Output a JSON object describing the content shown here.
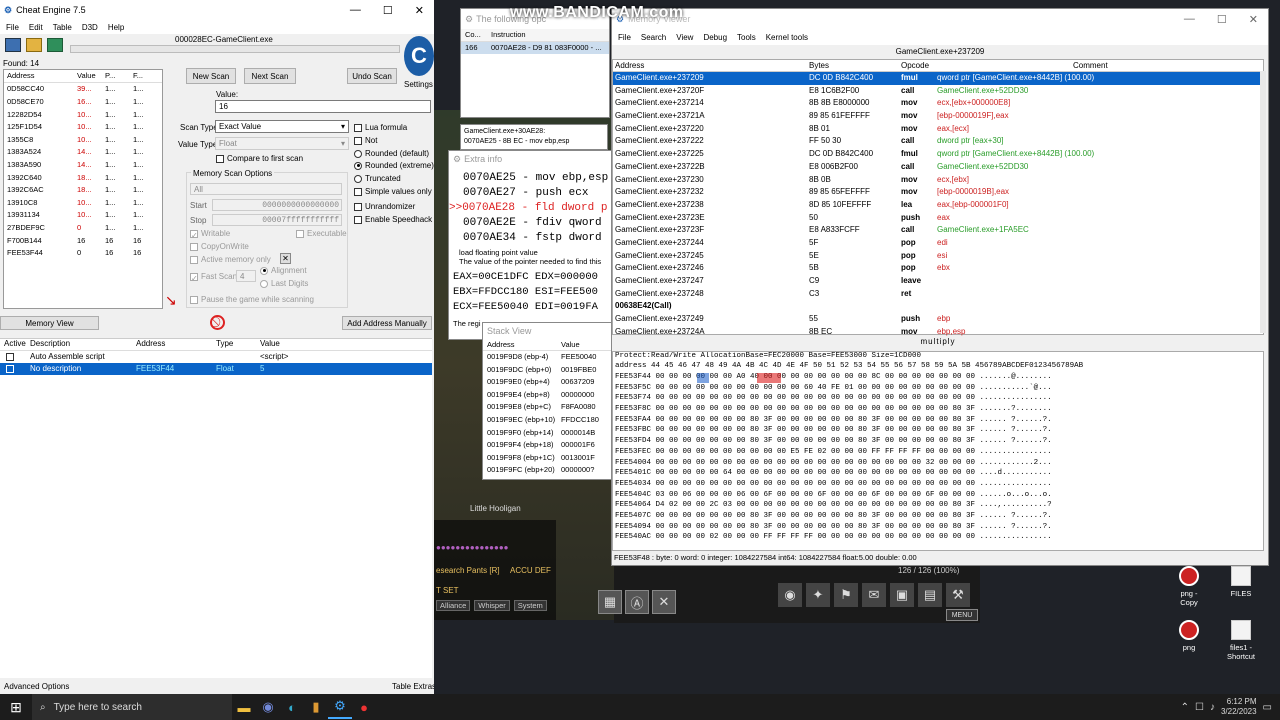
{
  "ce": {
    "title": "Cheat Engine 7.5",
    "menu": [
      "File",
      "Edit",
      "Table",
      "D3D",
      "Help"
    ],
    "process": "000028EC-GameClient.exe",
    "found": "Found: 14",
    "list_headers": [
      "Address",
      "Value",
      "P...",
      "F..."
    ],
    "rows": [
      [
        "0D58CC40",
        "39...",
        "1...",
        "1..."
      ],
      [
        "0D58CE70",
        "16...",
        "1...",
        "1..."
      ],
      [
        "12282D54",
        "10...",
        "1...",
        "1..."
      ],
      [
        "125F1D54",
        "10...",
        "1...",
        "1..."
      ],
      [
        "1355C8",
        "10...",
        "1...",
        "1..."
      ],
      [
        "1383A524",
        "14...",
        "1...",
        "1..."
      ],
      [
        "1383A590",
        "14...",
        "1...",
        "1..."
      ],
      [
        "1392C640",
        "18...",
        "1...",
        "1..."
      ],
      [
        "1392C6AC",
        "18...",
        "1...",
        "1..."
      ],
      [
        "13910C8",
        "10...",
        "1...",
        "1..."
      ],
      [
        "13931134",
        "10...",
        "1...",
        "1..."
      ],
      [
        "27BDEF9C",
        "0",
        "1...",
        "1..."
      ],
      [
        "F700B144",
        "16",
        "16",
        "16"
      ],
      [
        "FEE53F44",
        "0",
        "16",
        "16"
      ]
    ],
    "new_scan": "New Scan",
    "next_scan": "Next Scan",
    "undo_scan": "Undo Scan",
    "settings": "Settings",
    "value_label": "Value:",
    "value": "16",
    "scan_type_label": "Scan Type",
    "scan_type": "Exact Value",
    "value_type_label": "Value Type",
    "value_type": "Float",
    "compare_first": "Compare to first scan",
    "mem_opts": "Memory Scan Options",
    "mem_all": "All",
    "start_label": "Start",
    "start": "0000000000000000",
    "stop_label": "Stop",
    "stop": "00007fffffffffff",
    "writable": "Writable",
    "executable": "Executable",
    "copyonwrite": "CopyOnWrite",
    "active_mem": "Active memory only",
    "fast_scan": "Fast Scan",
    "fast_val": "4",
    "alignment": "Alignment",
    "last_digits": "Last Digits",
    "pause": "Pause the game while scanning",
    "lua": "Lua formula",
    "not": "Not",
    "rounded_default": "Rounded (default)",
    "rounded_extreme": "Rounded (extreme)",
    "truncated": "Truncated",
    "simple": "Simple values only",
    "unrandomizer": "Unrandomizer",
    "speedhack": "Enable Speedhack",
    "memory_view": "Memory View",
    "add_manual": "Add Address Manually",
    "table_headers": [
      "Active",
      "Description",
      "Address",
      "Type",
      "Value"
    ],
    "table_rows": [
      [
        "",
        "Auto Assemble script",
        "",
        "",
        "<script>"
      ],
      [
        "",
        "No description",
        "FEE53F44",
        "Float",
        "5"
      ]
    ],
    "advanced": "Advanced Options",
    "table_extras": "Table Extras"
  },
  "opcodes": {
    "title": "The following opc",
    "headers": [
      "Co...",
      "Instruction"
    ],
    "row": [
      "166",
      "0070AE28 - D9 81 083F0000 - ..."
    ],
    "tip": "GameClient.exe+30AE28:",
    "tip2": "0070AE25 - 8B EC - mov ebp,esp"
  },
  "extra": {
    "title": "Extra info",
    "lines": [
      "0070AE25 - mov ebp,esp",
      "0070AE27 - push ecx",
      ">>0070AE28 - fld dword p",
      "0070AE2E - fdiv qword",
      "0070AE34 - fstp dword"
    ],
    "note1": "load floating point value",
    "note2": "The value of the pointer needed to find this",
    "regs": [
      "EAX=00CE1DFC  EDX=000000",
      "EBX=FFDCC180  ESI=FEE500",
      "ECX=FEE50040  EDI=0019FA"
    ],
    "regs_note": "The regi"
  },
  "stack": {
    "title": "Stack View",
    "headers": [
      "Address",
      "Value"
    ],
    "rows": [
      [
        "0019F9D8 (ebp-4)",
        "FEE50040"
      ],
      [
        "0019F9DC (ebp+0)",
        "0019FBE0"
      ],
      [
        "0019F9E0 (ebp+4)",
        "00637209"
      ],
      [
        "0019F9E4 (ebp+8)",
        "00000000"
      ],
      [
        "0019F9E8 (ebp+C)",
        "F8FA0080"
      ],
      [
        "0019F9EC (ebp+10)",
        "FFDCC180"
      ],
      [
        "0019F9F0 (ebp+14)",
        "0000014B"
      ],
      [
        "0019F9F4 (ebp+18)",
        "000001F6"
      ],
      [
        "0019F9F8 (ebp+1C)",
        "0013001F"
      ],
      [
        "0019F9FC (ebp+20)",
        "0000000?"
      ]
    ]
  },
  "watermark": "www.BANDICAM.com",
  "memview": {
    "title": "Memory Viewer",
    "menu": [
      "File",
      "Search",
      "View",
      "Debug",
      "Tools",
      "Kernel tools"
    ],
    "location": "GameClient.exe+237209",
    "headers": [
      "Address",
      "Bytes",
      "Opcode",
      "Comment"
    ],
    "rows": [
      [
        "GameClient.exe+237209",
        "DC 0D B842C400",
        "fmul",
        "qword ptr [GameClient.exe+8442B] (100.00)"
      ],
      [
        "GameClient.exe+23720F",
        "E8 1C6B2F00",
        "call",
        "GameClient.exe+52DD30"
      ],
      [
        "GameClient.exe+237214",
        "8B 8B E8000000",
        "mov",
        "ecx,[ebx+000000E8]"
      ],
      [
        "GameClient.exe+23721A",
        "89 85 61FEFFFF",
        "mov",
        "[ebp-0000019F],eax"
      ],
      [
        "GameClient.exe+237220",
        "8B 01",
        "mov",
        "eax,[ecx]"
      ],
      [
        "GameClient.exe+237222",
        "FF 50 30",
        "call",
        "dword ptr [eax+30]"
      ],
      [
        "GameClient.exe+237225",
        "DC 0D B842C400",
        "fmul",
        "qword ptr [GameClient.exe+8442B] (100.00)"
      ],
      [
        "GameClient.exe+23722B",
        "E8 006B2F00",
        "call",
        "GameClient.exe+52DD30"
      ],
      [
        "GameClient.exe+237230",
        "8B 0B",
        "mov",
        "ecx,[ebx]"
      ],
      [
        "GameClient.exe+237232",
        "89 85 65FEFFFF",
        "mov",
        "[ebp-0000019B],eax"
      ],
      [
        "GameClient.exe+237238",
        "8D 85 10FEFFFF",
        "lea",
        "eax,[ebp-000001F0]"
      ],
      [
        "GameClient.exe+23723E",
        "50",
        "push",
        "eax"
      ],
      [
        "GameClient.exe+23723F",
        "E8 A833FCFF",
        "call",
        "GameClient.exe+1FA5EC"
      ],
      [
        "GameClient.exe+237244",
        "5F",
        "pop",
        "edi"
      ],
      [
        "GameClient.exe+237245",
        "5E",
        "pop",
        "esi"
      ],
      [
        "GameClient.exe+237246",
        "5B",
        "pop",
        "ebx"
      ],
      [
        "GameClient.exe+237247",
        "C9",
        "leave",
        ""
      ],
      [
        "GameClient.exe+237248",
        "C3",
        "ret",
        ""
      ],
      [
        "00638E42(Call)",
        "",
        "",
        ""
      ],
      [
        "GameClient.exe+237249",
        "55",
        "push",
        "ebp"
      ],
      [
        "GameClient.exe+23724A",
        "8B EC",
        "mov",
        "ebp,esp"
      ]
    ],
    "status": "multiply",
    "hex_info": "Protect:Read/Write  AllocationBase=FEC20000 Base=FEE53000 Size=1CD000",
    "hex_header": "address  44 45 46 47 48 49 4A 4B 4C 4D 4E 4F 50 51 52 53 54 55 56 57 58 59 5A 5B 456789ABCDEF0123456789AB",
    "hex_rows": [
      "FEE53F44 00 00 00 00 00 00 A0 40 00 00 00 00 00 00 00 00 8C 00 00 00 00 00 00 00 .......@........",
      "FEE53F5C 00 00 00 00 00 00 00 00 00 00 00 60 40 FE 01 00 00 00 00 00 00 00 00 00 ...........`@...",
      "FEE53F74 00 00 00 00 00 00 00 00 00 00 00 00 00 00 00 00 00 00 00 00 00 00 00 00 ................",
      "FEE53F8C 00 00 00 00 00 00 00 00 00 00 00 00 00 00 00 00 00 00 00 00 00 00 80 3F .......?........",
      "FEE53FA4 00 00 00 00 00 00 00 80 3F 00 00 00 00 00 00 80 3F 00 00 00 00 00 80 3F ...... ?......?.",
      "FEE53FBC 00 00 00 00 00 00 00 80 3F 00 00 00 00 00 00 80 3F 00 00 00 00 00 80 3F ...... ?......?.",
      "FEE53FD4 00 00 00 00 00 00 00 80 3F 00 00 00 00 00 00 80 3F 00 00 00 00 00 80 3F ...... ?......?.",
      "FEE53FEC 00 00 00 00 00 00 00 00 00 00 E5 FE 02 00 00 00 FF FF FF FF 00 00 00 00 ................",
      "FEE54004 00 00 00 00 00 00 00 00 00 00 00 00 00 00 00 00 00 00 00 00 32 00 00 00 ............2...",
      "FEE5401C 00 00 00 00 00 64 00 00 00 00 00 00 00 00 00 00 00 00 00 00 00 00 00 00 ....d...........",
      "FEE54034 00 00 00 00 00 00 00 00 00 00 00 00 00 00 00 00 00 00 00 00 00 00 00 00 ................",
      "FEE5404C 03 00 06 00 00 00 06 00 6F 00 00 00 6F 00 00 00 6F 00 00 00 6F 00 00 00 ......o...o...o.",
      "FEE54064 D4 02 00 00 2C 03 00 00 00 00 00 00 00 00 00 00 00 00 00 00 00 00 80 3F ....,..........?",
      "FEE5407C 00 00 00 00 00 00 00 80 3F 00 00 00 00 00 00 80 3F 00 00 00 00 00 80 3F ...... ?......?.",
      "FEE54094 00 00 00 00 00 00 00 80 3F 00 00 00 00 00 00 80 3F 00 00 00 00 00 80 3F ...... ?......?.",
      "FEE540AC 00 00 00 00 02 00 00 00 FF FF FF FF 00 00 00 00 00 00 00 00 00 00 00 00 ................"
    ],
    "bottom_status": "FEE53F48 : byte: 0 word: 0 integer: 1084227584 int64: 1084227584 float:5.00 double: 0.00"
  },
  "game": {
    "player": "Little Hooligan",
    "item_text": "esearch Pants [R]",
    "item_sub": "ACCU DEF",
    "set_label": "T SET",
    "tabs": [
      "Alliance",
      "Whisper",
      "System"
    ],
    "hp": "126 / 126 (100%)",
    "menu_label": "MENU"
  },
  "desktop": {
    "icons": [
      {
        "label": "png - Copy",
        "icon": "png-icon"
      },
      {
        "label": "FILES",
        "icon": "folder-icon"
      },
      {
        "label": "png",
        "icon": "png-icon"
      },
      {
        "label": "files1 - Shortcut",
        "icon": "folder-icon"
      }
    ]
  },
  "taskbar": {
    "search": "Type here to search",
    "time": "6:12 PM",
    "date": "3/22/2023"
  }
}
